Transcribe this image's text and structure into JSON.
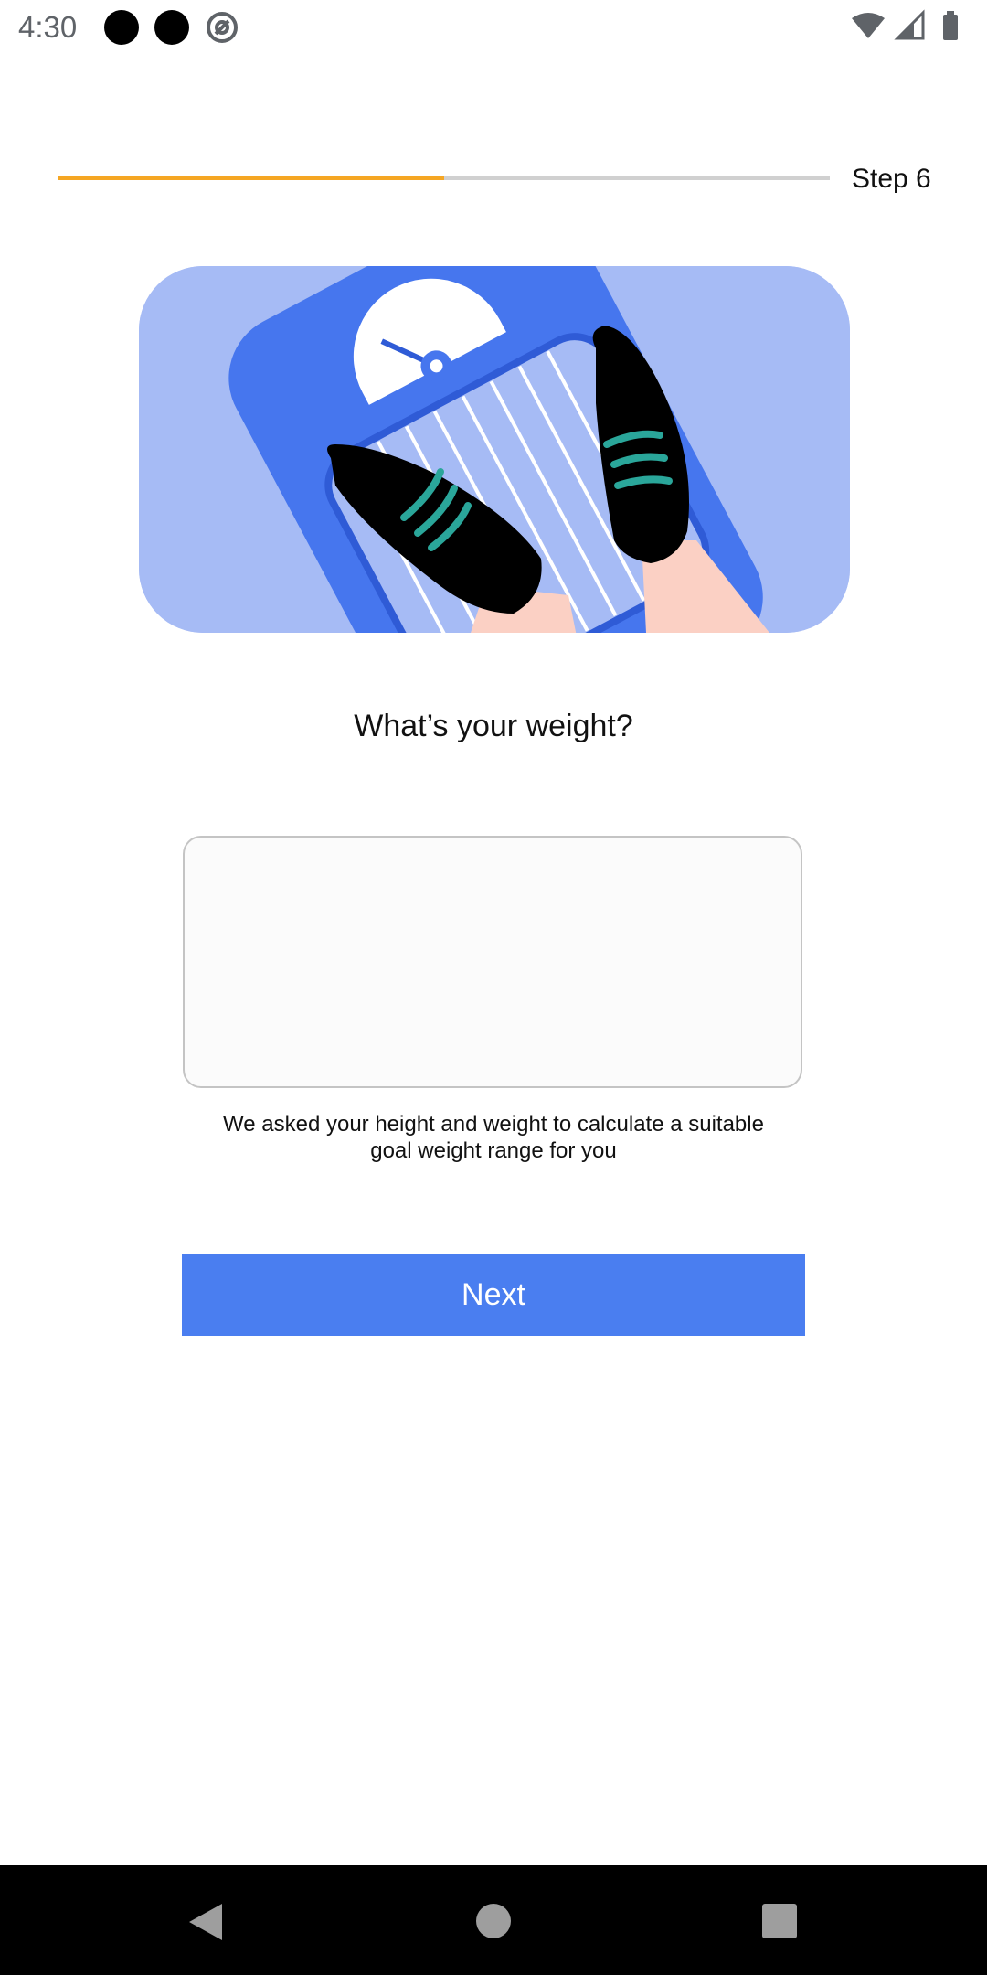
{
  "status_bar": {
    "time": "4:30"
  },
  "progress": {
    "step_label": "Step 6",
    "fraction": 0.5,
    "track_color": "#d0d0d0",
    "fill_color": "#f5a623"
  },
  "illustration": {
    "icon": "scale-with-shoes-illustration"
  },
  "question": "What’s your weight?",
  "weight_input": {
    "value": "",
    "placeholder": ""
  },
  "helper_text": "We asked your height and weight to calculate a suitable goal weight range for you",
  "next_button": {
    "label": "Next",
    "color": "#4a7ef0"
  },
  "nav_bar": {
    "back_icon": "back-triangle-icon",
    "home_icon": "home-circle-icon",
    "recents_icon": "recents-square-icon"
  }
}
